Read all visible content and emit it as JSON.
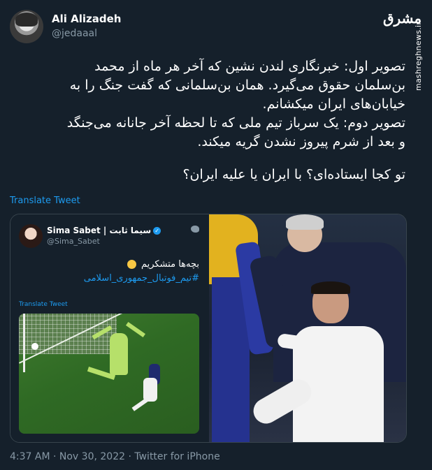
{
  "author": {
    "name": "Ali Alizadeh",
    "handle": "@jedaaal"
  },
  "watermark": {
    "logo": "مشرق",
    "side": "mashreghnews.ir"
  },
  "tweet": {
    "lines": [
      "تصویر اول: خبرنگاری لندن نشین که آخر هر ماه از محمد",
      "بن‌سلمان حقوق می‌گیرد. همان بن‌سلمانی که گفت جنگ را به",
      "خیابان‌های ایران میکشانم.",
      "تصویر دوم: یک سرباز تیم ملی که تا لحظه آخر جانانه می‌جنگد",
      "و بعد از شرم پیروز نشدن گریه میکند.",
      "تو کجا ایستاده‌ای؟ با ایران یا علیه ایران؟"
    ],
    "translate": "Translate Tweet"
  },
  "embedded": {
    "name": "Sima Sabet | سیما ثابت",
    "handle": "@Sima_Sabet",
    "text": "بچه‌ها متشکریم",
    "hashtag": "#تیم_فوتبال_جمهوری_اسلامی",
    "translate": "Translate Tweet"
  },
  "footer": "4:37 AM · Nov 30, 2022 · Twitter for iPhone"
}
